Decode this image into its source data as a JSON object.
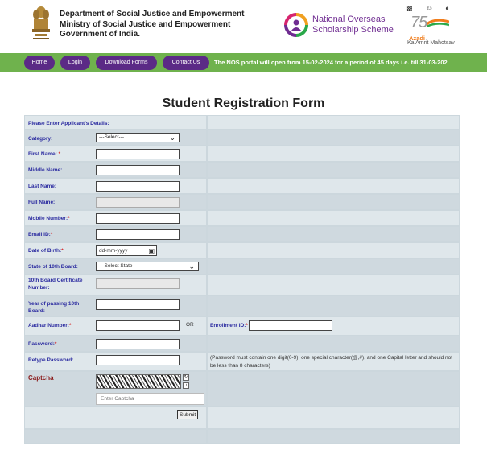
{
  "header": {
    "department": [
      "Department of Social Justice and Empowerment",
      "Ministry of Social Justice and Empowerment",
      "Government of India."
    ],
    "scheme_line1": "National Overseas",
    "scheme_line2": "Scholarship Scheme",
    "azadi_number": "75",
    "azadi_word": "Azadi",
    "azadi_line2": "Ka Amrit Mahotsav",
    "icons": [
      "sitemap-icon",
      "accessibility-icon",
      "contrast-icon"
    ]
  },
  "nav": {
    "home": "Home",
    "login": "Login",
    "download_forms": "Download Forms",
    "contact_us": "Contact Us",
    "marquee": "The NOS portal will open from 15-02-2024 for a period of 45 days i.e. till 31-03-202"
  },
  "form": {
    "title": "Student Registration Form",
    "section_heading": "Please Enter Applicant's Details:",
    "category_label": "Category:",
    "category_value": "---Select---",
    "first_name_label": "First Name:",
    "middle_name_label": "Middle Name:",
    "last_name_label": "Last Name:",
    "full_name_label": "Full Name:",
    "mobile_label": "Mobile Number:",
    "email_label": "Email ID:",
    "dob_label": "Date of Birth:",
    "dob_placeholder": "dd-mm-yyyy",
    "state_label": "State of 10th Board:",
    "state_value": "---Select State---",
    "cert_label_1": "10th Board Certificate",
    "cert_label_2": "Number:",
    "year_label_1": "Year of passing 10th",
    "year_label_2": "Board:",
    "aadhar_label": "Aadhar Number:",
    "or_text": "OR",
    "enrollment_label": "Enrollment ID:",
    "password_label": "Password:",
    "retype_label": "Retype Password:",
    "password_note": "(Password must contain one digit(0-9), one special character(@,#), and one Capital letter and should not be less than 8 characters)",
    "captcha_label": "Captcha",
    "captcha_placeholder": "Enter Captcha",
    "submit_label": "Submit",
    "required_mark": "*"
  },
  "colors": {
    "nav_green": "#6fb24d",
    "nav_button": "#5b2a86",
    "label_blue": "#2b2ba0",
    "required_red": "#d62020",
    "scheme_purple": "#6f2c91"
  }
}
